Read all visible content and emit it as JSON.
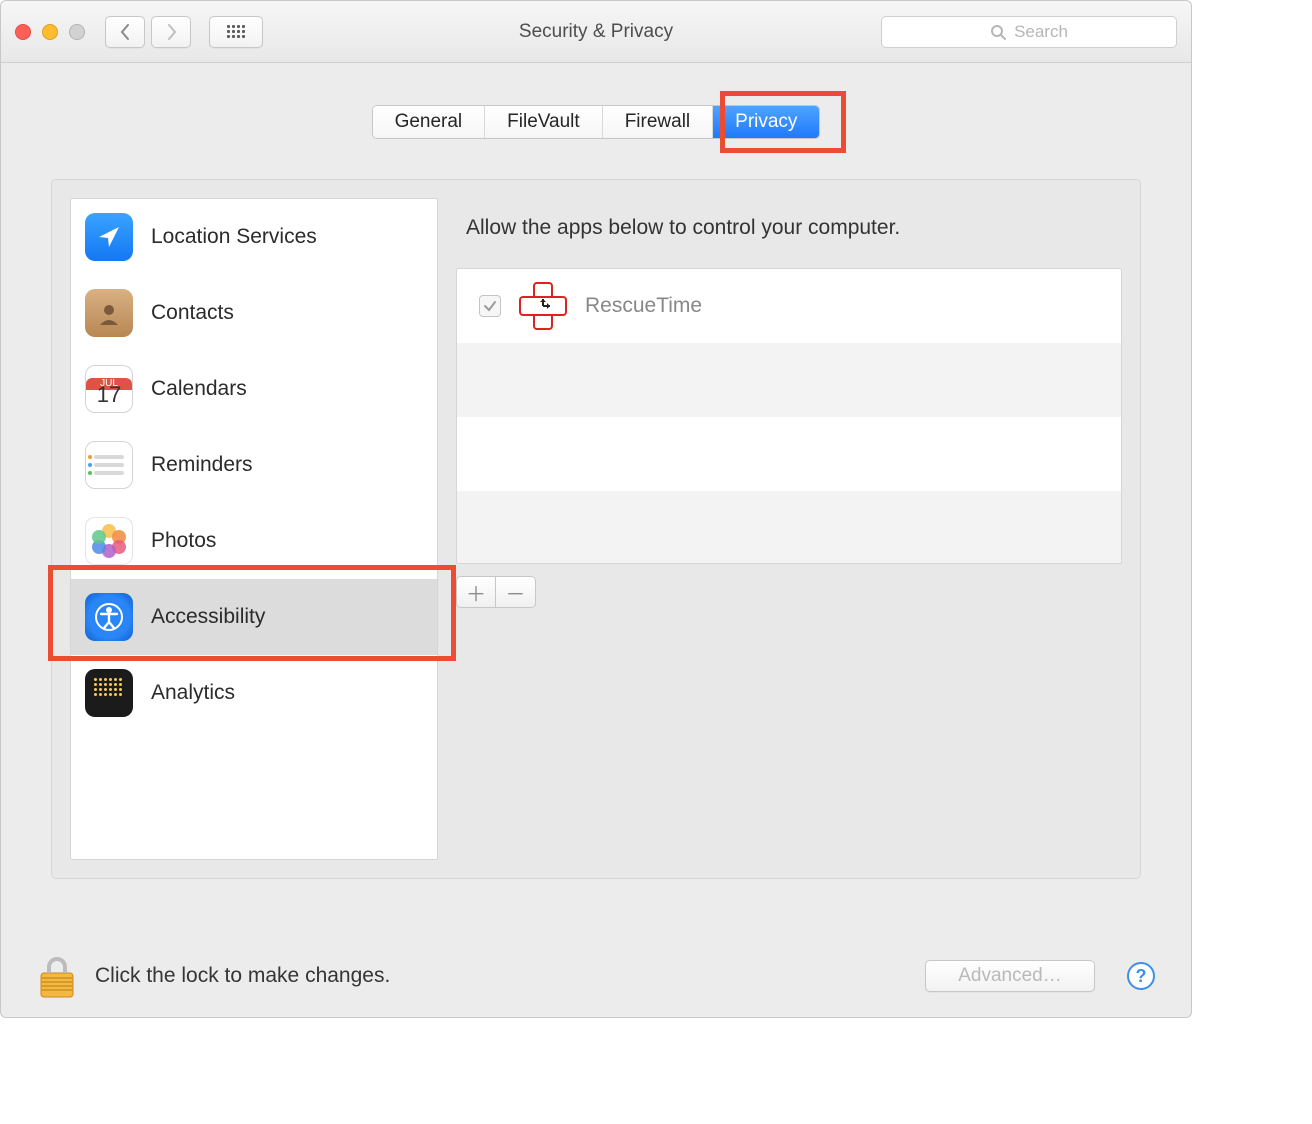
{
  "window": {
    "title": "Security & Privacy"
  },
  "search": {
    "placeholder": "Search"
  },
  "tabs": [
    "General",
    "FileVault",
    "Firewall",
    "Privacy"
  ],
  "tabs_active_index": 3,
  "sidebar": {
    "items": [
      {
        "label": "Location Services",
        "icon": "location-icon"
      },
      {
        "label": "Contacts",
        "icon": "contacts-icon"
      },
      {
        "label": "Calendars",
        "icon": "calendar-icon",
        "badge_top": "JUL",
        "badge_day": "17"
      },
      {
        "label": "Reminders",
        "icon": "reminders-icon"
      },
      {
        "label": "Photos",
        "icon": "photos-icon"
      },
      {
        "label": "Accessibility",
        "icon": "accessibility-icon",
        "selected": true
      },
      {
        "label": "Analytics",
        "icon": "analytics-icon"
      }
    ]
  },
  "main": {
    "hint": "Allow the apps below to control your computer.",
    "apps": [
      {
        "name": "RescueTime",
        "checked": true
      }
    ]
  },
  "footer": {
    "text": "Click the lock to make changes.",
    "advanced": "Advanced…"
  },
  "highlights": {
    "privacy_tab": true,
    "accessibility_item": true
  }
}
